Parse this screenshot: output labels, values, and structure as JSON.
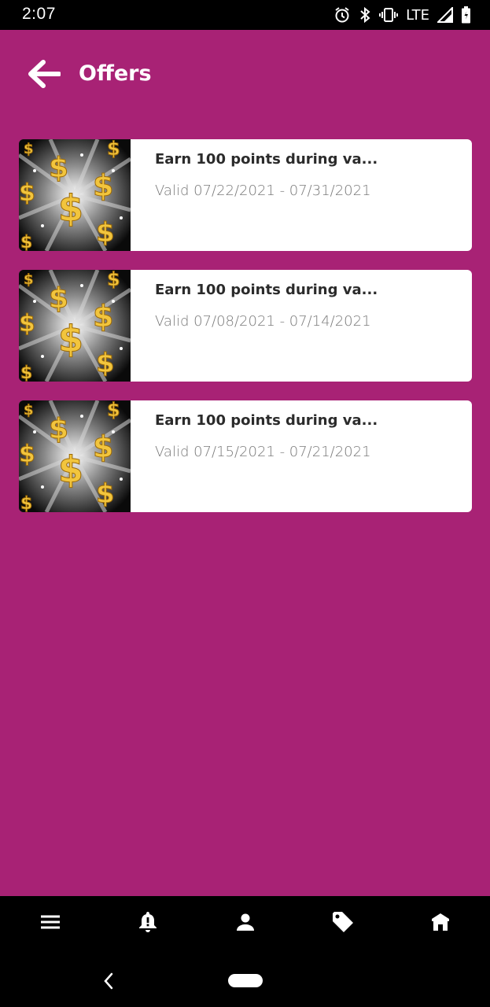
{
  "status_bar": {
    "time": "2:07",
    "network": "LTE",
    "icons": [
      "alarm-icon",
      "bluetooth-icon",
      "vibrate-icon",
      "signal-icon",
      "battery-icon"
    ]
  },
  "header": {
    "title": "Offers",
    "back_icon": "arrow-left-icon"
  },
  "offers": [
    {
      "title": "Earn 100 points during va...",
      "valid": "Valid 07/22/2021 - 07/31/2021",
      "image": "gold-dollar-signs"
    },
    {
      "title": "Earn 100 points during va...",
      "valid": "Valid 07/08/2021 - 07/14/2021",
      "image": "gold-dollar-signs"
    },
    {
      "title": "Earn 100 points during va...",
      "valid": "Valid 07/15/2021 - 07/21/2021",
      "image": "gold-dollar-signs"
    }
  ],
  "bottom_nav": {
    "items": [
      "menu-icon",
      "notification-icon",
      "profile-icon",
      "offers-tag-icon",
      "store-icon"
    ]
  },
  "colors": {
    "background": "#a82275",
    "card": "#ffffff",
    "bars": "#000000",
    "coin_gold": "#f2c53d"
  }
}
